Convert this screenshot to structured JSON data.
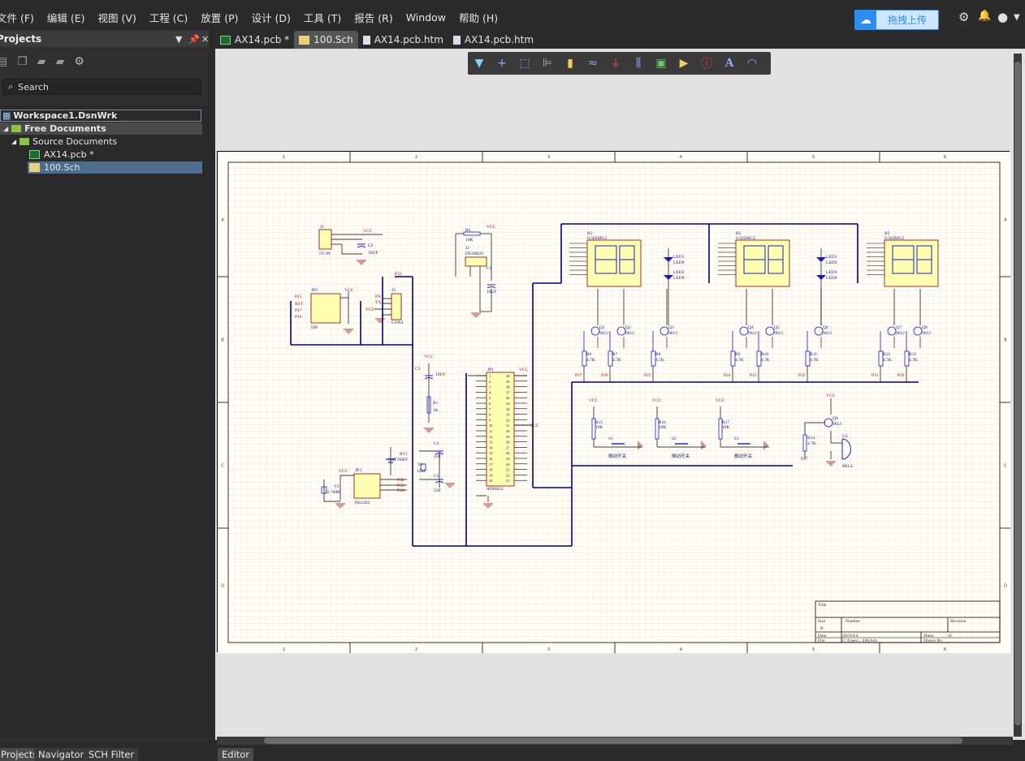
{
  "menu": [
    "文件 (F)",
    "编辑 (E)",
    "视图 (V)",
    "工程 (C)",
    "放置 (P)",
    "设计 (D)",
    "工具 (T)",
    "报告 (R)",
    "Window",
    "帮助 (H)"
  ],
  "upload_label": "拖拽上传",
  "panel": {
    "title": "Projects",
    "search_placeholder": "Search",
    "tree": [
      "Workspace1.DsnWrk",
      "Free Documents",
      "Source Documents",
      "AX14.pcb *",
      "100.Sch"
    ]
  },
  "tabs": [
    "AX14.pcb *",
    "100.Sch",
    "AX14.pcb.htm",
    "AX14.pcb.htm"
  ],
  "bottom_tabs": [
    "Projects",
    "Navigator",
    "SCH Filter"
  ],
  "editor_tab": "Editor",
  "colors": {
    "wire": "#1a1a9c",
    "bus": "#000080",
    "component_fill": "#ffffb0",
    "component_border": "#8b0000",
    "power": "#8b0000",
    "accent": "#2d8cf0"
  },
  "sheet": {
    "zones_x": [
      "1",
      "2",
      "3",
      "4",
      "5",
      "6"
    ],
    "zones_y": [
      "A",
      "B",
      "C",
      "D"
    ],
    "title_block": {
      "title": "Title",
      "size": "Size",
      "size_value": "B",
      "number": "Number",
      "revision": "Revision",
      "date": "Date",
      "date_value": "2019/6/4",
      "sheet": "Sheet",
      "of": "of",
      "file": "File",
      "file_value": "C:\\Users\\..\\100.Sch",
      "drawn_by": "Drawn By:"
    },
    "labels": [
      "J1",
      "5V IN",
      "VCC",
      "C2",
      "10UF",
      "R4",
      "10K",
      "VCC",
      "J2",
      "DS18B20",
      "C1",
      "10UF",
      "P33",
      "JP2",
      "ISP",
      "P15",
      "RST",
      "P17",
      "P16",
      "VCC",
      "J3",
      "CON4",
      "PX",
      "TX",
      "VCC",
      "R2",
      "0.56SMG2",
      "R3",
      "0.56SMG2",
      "R5",
      "0.56SMG2",
      "LED1",
      "LED0",
      "LED2",
      "LED0",
      "LED3",
      "LED0",
      "LED4",
      "LED0",
      "Q1",
      "9012",
      "Q2",
      "9012",
      "Q3",
      "9012",
      "Q4",
      "9012",
      "Q5",
      "9012",
      "Q6",
      "9012",
      "Q7",
      "9012",
      "Q8",
      "9012",
      "R6",
      "4.7K",
      "R7",
      "4.7K",
      "R8",
      "4.7K",
      "R9",
      "4.7K",
      "R10",
      "4.7K",
      "R11",
      "4.7K",
      "R12",
      "4.7K",
      "R13",
      "4.7K",
      "P27",
      "P26",
      "P25",
      "P24",
      "P23",
      "P22",
      "P21",
      "P20",
      "VCC",
      "C3",
      "10UF",
      "R1",
      "1K",
      "JP1",
      "AT89S52",
      "VCC",
      "VCC",
      "C4",
      "22P",
      "Y1",
      "12M",
      "C5",
      "22P",
      "BT1",
      "BATTERY",
      "VCC",
      "JP3",
      "DS1302",
      "Y2",
      "32.768K",
      "P36",
      "P35",
      "P34",
      "VCC",
      "R15",
      "10K",
      "VCC",
      "R16",
      "10K",
      "VCC",
      "R17",
      "10K",
      "S1",
      "微动开关",
      "S2",
      "微动开关",
      "S3",
      "微动开关",
      "VCC",
      "Q9",
      "9012",
      "R14",
      "4.7K",
      "U2",
      "BELL",
      "P37"
    ]
  }
}
